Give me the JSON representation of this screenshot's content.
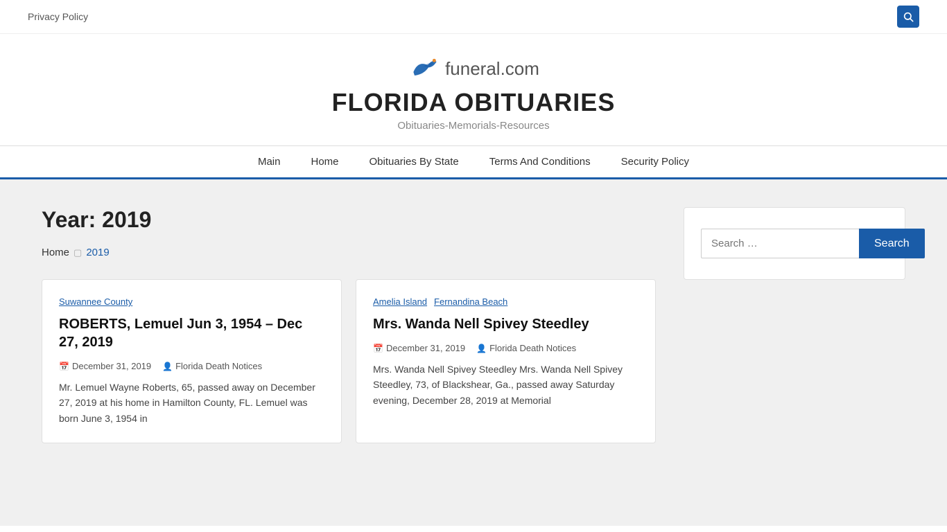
{
  "topbar": {
    "privacy_policy": "Privacy Policy"
  },
  "header": {
    "logo_text": "funeral.com",
    "site_title": "FLORIDA OBITUARIES",
    "tagline": "Obituaries-Memorials-Resources"
  },
  "nav": {
    "items": [
      {
        "label": "Main",
        "href": "#"
      },
      {
        "label": "Home",
        "href": "#"
      },
      {
        "label": "Obituaries By State",
        "href": "#"
      },
      {
        "label": "Terms And Conditions",
        "href": "#"
      },
      {
        "label": "Security Policy",
        "href": "#"
      }
    ]
  },
  "page": {
    "year_label": "Year:",
    "year_value": "2019",
    "breadcrumb_home": "Home",
    "breadcrumb_year": "2019"
  },
  "cards": [
    {
      "tags": [
        "Suwannee County"
      ],
      "title": "ROBERTS, Lemuel Jun 3, 1954 – Dec 27, 2019",
      "date": "December 31, 2019",
      "author": "Florida Death Notices",
      "excerpt": "Mr. Lemuel Wayne Roberts, 65, passed away on December 27, 2019 at his home in Hamilton County, FL. Lemuel was born June 3, 1954 in"
    },
    {
      "tags": [
        "Amelia Island",
        "Fernandina Beach"
      ],
      "title": "Mrs. Wanda Nell Spivey Steedley",
      "date": "December 31, 2019",
      "author": "Florida Death Notices",
      "excerpt": "Mrs. Wanda Nell Spivey Steedley Mrs. Wanda Nell Spivey Steedley, 73, of Blackshear, Ga., passed away Saturday evening, December 28, 2019 at Memorial"
    }
  ],
  "sidebar": {
    "search_placeholder": "Search …",
    "search_button": "Search"
  }
}
